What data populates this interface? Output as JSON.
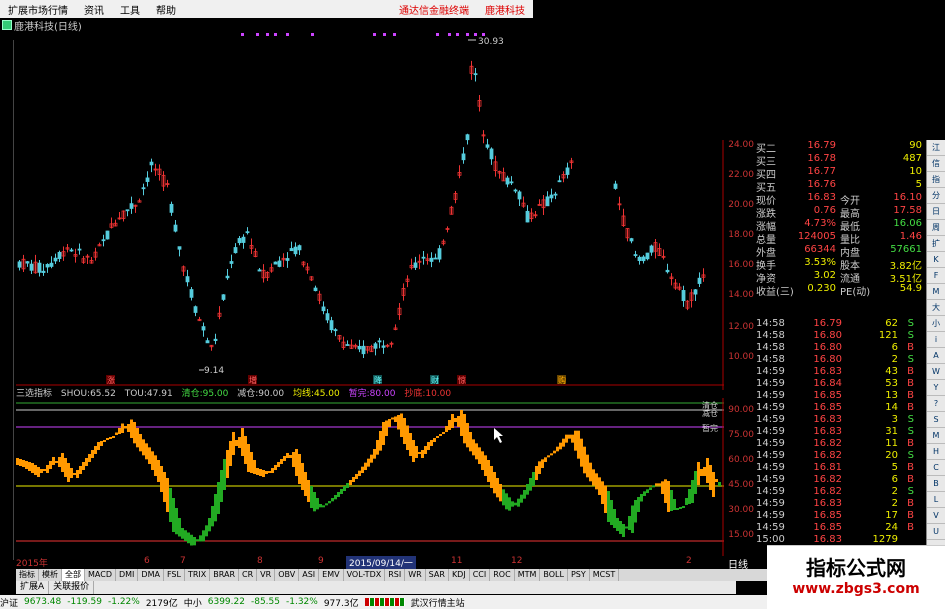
{
  "menu": {
    "items": [
      "扩展市场行情",
      "资讯",
      "工具",
      "帮助"
    ],
    "right": [
      "通达信金融终端",
      "鹿港科技"
    ]
  },
  "window": {
    "title": "鹿港科技(日线)"
  },
  "main_chart": {
    "high_label": "30.93",
    "low_label": "9.14",
    "markers": [
      "涨",
      "增",
      "降",
      "财",
      "惊",
      "购"
    ],
    "yaxis": [
      "24.00",
      "22.00",
      "20.00",
      "18.00",
      "16.00",
      "14.00",
      "12.00",
      "10.00"
    ]
  },
  "indicator": {
    "name": "三选指标",
    "items": [
      {
        "label": "SHOU:",
        "value": "65.52"
      },
      {
        "label": "TOU:",
        "value": "47.91"
      },
      {
        "label": "清仓:",
        "value": "95.00"
      },
      {
        "label": "减仓:",
        "value": "90.00"
      },
      {
        "label": "均线:",
        "value": "45.00"
      },
      {
        "label": "暂完:",
        "value": "80.00"
      },
      {
        "label": "抄底:",
        "value": "10.00"
      }
    ],
    "yaxis": [
      "90.00",
      "75.00",
      "60.00",
      "45.00",
      "30.00",
      "15.00"
    ],
    "right_labels": [
      "清仓",
      "减仓",
      "暂完"
    ]
  },
  "dates": [
    "2015年",
    "6",
    "7",
    "8",
    "9",
    "11",
    "12",
    "2"
  ],
  "date_highlight": "2015/09/14/一",
  "quotes": [
    {
      "l": "买二",
      "p": "16.79",
      "r": "",
      "rv": "90"
    },
    {
      "l": "买三",
      "p": "16.78",
      "r": "",
      "rv": "487"
    },
    {
      "l": "买四",
      "p": "16.77",
      "r": "",
      "rv": "10"
    },
    {
      "l": "买五",
      "p": "16.76",
      "r": "",
      "rv": "5"
    },
    {
      "l": "现价",
      "p": "16.83",
      "r": "今开",
      "rv": "16.10"
    },
    {
      "l": "涨跌",
      "p": "0.76",
      "r": "最高",
      "rv": "17.58"
    },
    {
      "l": "涨幅",
      "p": "4.73%",
      "r": "最低",
      "rv": "16.06"
    },
    {
      "l": "总量",
      "p": "124005",
      "r": "量比",
      "rv": "1.46"
    },
    {
      "l": "外盘",
      "p": "66344",
      "r": "内盘",
      "rv": "57661"
    },
    {
      "l": "换手",
      "p": "3.53%",
      "r": "股本",
      "rv": "3.82亿"
    },
    {
      "l": "净资",
      "p": "3.02",
      "r": "流通",
      "rv": "3.51亿"
    },
    {
      "l": "收益(三)",
      "p": "0.230",
      "r": "PE(动)",
      "rv": "54.9"
    }
  ],
  "ticks": [
    {
      "t": "14:58",
      "p": "16.79",
      "v": "62",
      "s": "S"
    },
    {
      "t": "14:58",
      "p": "16.80",
      "v": "121",
      "s": "S"
    },
    {
      "t": "14:58",
      "p": "16.80",
      "v": "6",
      "s": "B"
    },
    {
      "t": "14:58",
      "p": "16.80",
      "v": "2",
      "s": "S"
    },
    {
      "t": "14:59",
      "p": "16.83",
      "v": "43",
      "s": "B"
    },
    {
      "t": "14:59",
      "p": "16.84",
      "v": "53",
      "s": "B"
    },
    {
      "t": "14:59",
      "p": "16.85",
      "v": "13",
      "s": "B"
    },
    {
      "t": "14:59",
      "p": "16.85",
      "v": "14",
      "s": "B"
    },
    {
      "t": "14:59",
      "p": "16.83",
      "v": "3",
      "s": "S"
    },
    {
      "t": "14:59",
      "p": "16.83",
      "v": "31",
      "s": "S"
    },
    {
      "t": "14:59",
      "p": "16.82",
      "v": "11",
      "s": "B"
    },
    {
      "t": "14:59",
      "p": "16.82",
      "v": "20",
      "s": "S"
    },
    {
      "t": "14:59",
      "p": "16.81",
      "v": "5",
      "s": "B"
    },
    {
      "t": "14:59",
      "p": "16.82",
      "v": "6",
      "s": "B"
    },
    {
      "t": "14:59",
      "p": "16.82",
      "v": "2",
      "s": "S"
    },
    {
      "t": "14:59",
      "p": "16.83",
      "v": "2",
      "s": "B"
    },
    {
      "t": "14:59",
      "p": "16.85",
      "v": "17",
      "s": "B"
    },
    {
      "t": "14:59",
      "p": "16.85",
      "v": "24",
      "s": "B"
    },
    {
      "t": "15:00",
      "p": "16.83",
      "v": "1279",
      "s": ""
    }
  ],
  "tabs": [
    "指标",
    "模析",
    "全部",
    "MACD",
    "DMI",
    "DMA",
    "FSL",
    "TRIX",
    "BRAR",
    "CR",
    "VR",
    "OBV",
    "ASI",
    "EMV",
    "VOL-TDX",
    "RSI",
    "WR",
    "SAR",
    "KDJ",
    "CCI",
    "ROC",
    "MTM",
    "BOLL",
    "PSY",
    "MCST"
  ],
  "subtabs": [
    "扩展A",
    "关联报价"
  ],
  "side_label": "日线",
  "status": {
    "sh_label": "沪证",
    "sh": "9673.48",
    "sh_chg": "-119.59",
    "sh_pct": "-1.22%",
    "sh_amt": "2179亿",
    "zx_label": "中小",
    "zx": "6399.22",
    "zx_chg": "-85.55",
    "zx_pct": "-1.32%",
    "zx_amt": "977.3亿",
    "site": "武汉行情主站"
  },
  "brand": {
    "title": "指标公式网",
    "url": "www.zbgs3.com"
  },
  "right_toolbar": [
    "江",
    "信",
    "指",
    "分",
    "日",
    "周",
    "扩",
    "K",
    "F",
    "M",
    "大",
    "小",
    "i",
    "A",
    "W",
    "Y",
    "?",
    "S",
    "M",
    "H",
    "C",
    "B",
    "L",
    "V",
    "U"
  ]
}
